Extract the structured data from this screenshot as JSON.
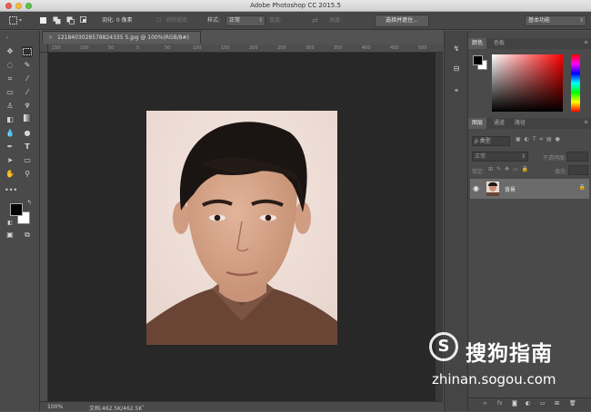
{
  "app": {
    "title": "Adobe Photoshop CC 2015.5"
  },
  "options": {
    "feather_label": "羽化: 0 像素",
    "antialias_label": "消除锯齿",
    "style_label": "样式:",
    "style_value": "正常",
    "width_label": "宽度:",
    "height_label": "高度:",
    "select_mask_button": "选择并遮住...",
    "workspace_value": "基本功能"
  },
  "document": {
    "tab_title": "1218403028578824335 5.jpg @ 100%(RGB/8#)",
    "ruler_ticks": [
      "150",
      "100",
      "50",
      "0",
      "50",
      "100",
      "150",
      "200",
      "250",
      "300",
      "350",
      "400",
      "450",
      "500"
    ]
  },
  "status": {
    "zoom": "100%",
    "doc_info": "文档:462.5K/462.5K"
  },
  "panels": {
    "color_tabs": [
      "颜色",
      "色板"
    ],
    "layer_tabs": [
      "图层",
      "通道",
      "路径"
    ],
    "filter_kind": "ρ 类型",
    "blend_mode": "正常",
    "opacity_label": "不透明度:",
    "lock_label": "锁定:",
    "fill_label": "填充:",
    "layer_name": "背景"
  },
  "watermark": {
    "logo_glyph": "S",
    "title": "搜狗指南",
    "url": "zhinan.sogou.com"
  },
  "colors": {
    "fg": "#000000",
    "bg": "#ffffff",
    "accent_hue": "#ff0000"
  }
}
